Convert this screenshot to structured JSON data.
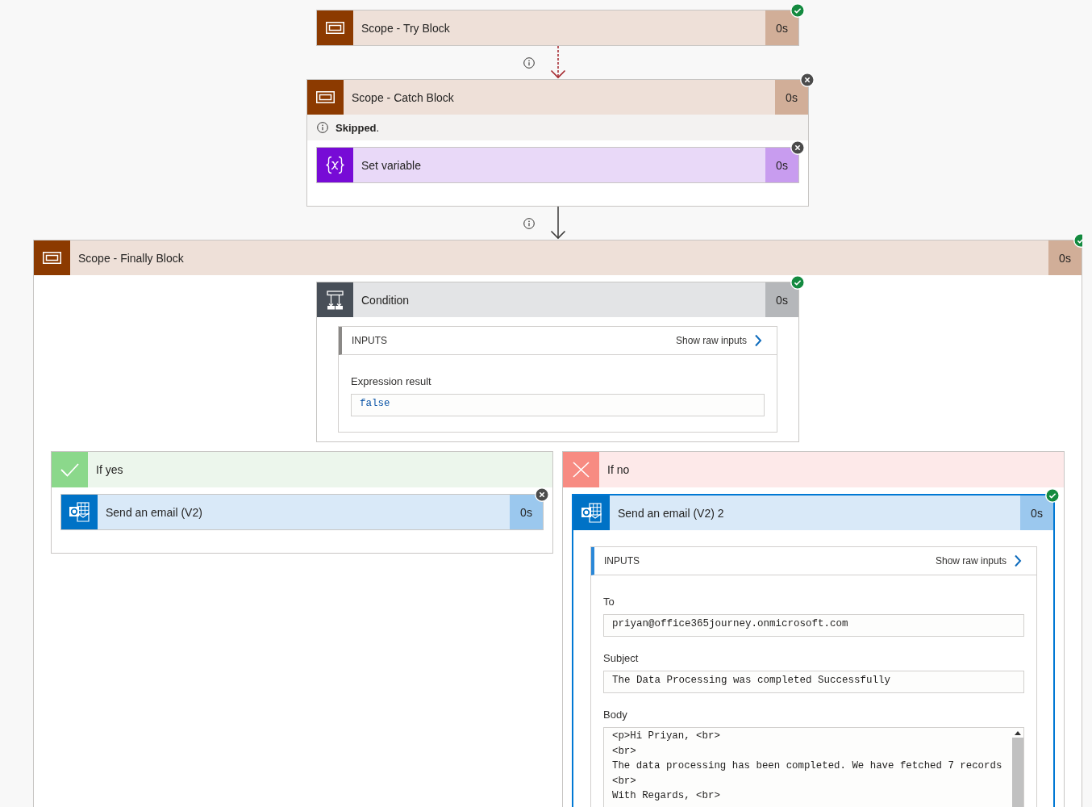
{
  "flow": [
    {
      "kind": "scope",
      "title": "Scope - Try Block",
      "duration": "0s",
      "skipped": false,
      "selected": false
    },
    {
      "kind": "connector",
      "dashed": true
    },
    {
      "kind": "scope",
      "title": "Scope - Catch Block",
      "duration": "0s",
      "skipped": true,
      "selected": false,
      "notice": "**Skipped**.",
      "children": [
        {
          "kind": "variable",
          "title": "Set variable",
          "duration": "0s",
          "skipped": true,
          "selected": false
        }
      ]
    },
    {
      "kind": "connector",
      "dashed": false
    },
    {
      "kind": "scope",
      "title": "Scope - Finally Block",
      "duration": "0s",
      "skipped": false,
      "selected": false,
      "children": [
        {
          "kind": "condition",
          "title": "Condition",
          "duration": "0s",
          "skipped": false,
          "selected": false,
          "inputs": {
            "heading": "INPUTS",
            "link": "Show raw inputs",
            "fields": [
              {
                "kind": "boolean",
                "label": "Expression result",
                "value": "false"
              }
            ]
          },
          "branches": [
            {
              "kind": "yes",
              "title": "If yes",
              "children": [
                {
                  "kind": "email",
                  "title": "Send an email (V2)",
                  "duration": "0s",
                  "skipped": true,
                  "selected": false
                }
              ]
            },
            {
              "kind": "no",
              "title": "If no",
              "children": [
                {
                  "kind": "email",
                  "title": "Send an email (V2) 2",
                  "duration": "0s",
                  "skipped": false,
                  "selected": true,
                  "inputs": {
                    "heading": "INPUTS",
                    "link": "Show raw inputs",
                    "fields": [
                      {
                        "kind": "text",
                        "label": "To",
                        "value": "priyan@office365journey.onmicrosoft.com"
                      },
                      {
                        "kind": "text",
                        "label": "Subject",
                        "value": "The Data Processing was completed Successfully"
                      },
                      {
                        "kind": "multiline",
                        "label": "Body",
                        "lines": [
                          "<p>Hi Priyan, <br>",
                          "<br>",
                          "The data processing has been completed. We have fetched 7 records",
                          "<br>",
                          "With Regards, <br>"
                        ]
                      }
                    ]
                  }
                }
              ]
            }
          ]
        }
      ]
    }
  ]
}
